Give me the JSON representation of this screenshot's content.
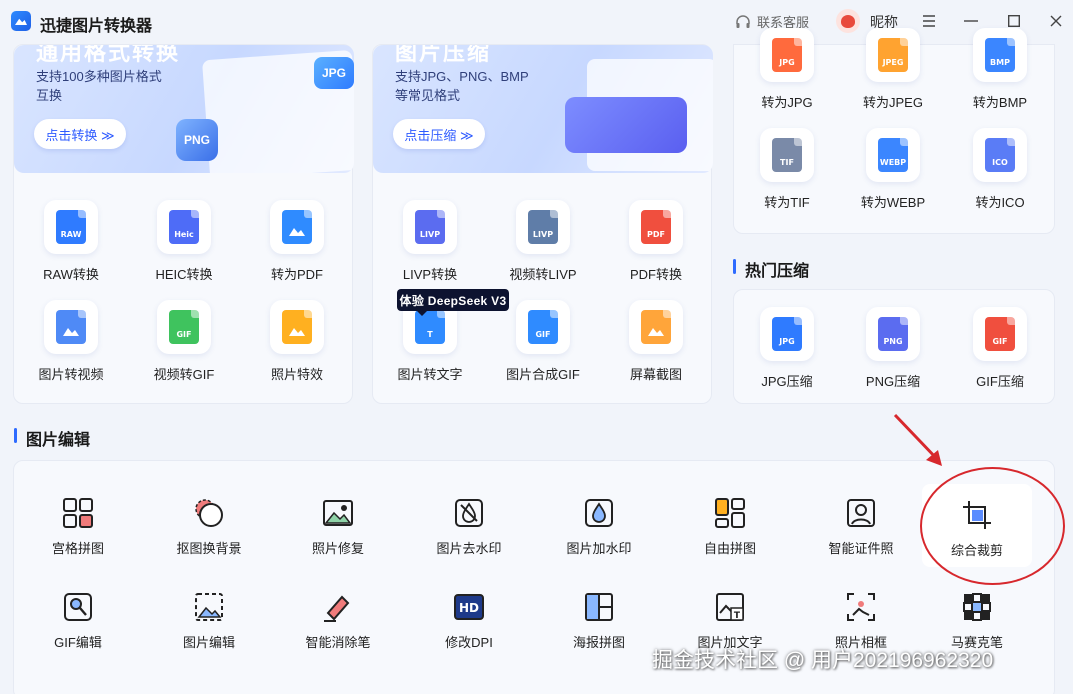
{
  "app": {
    "title": "迅捷图片转换器",
    "support_label": "联系客服",
    "nickname": "昵称"
  },
  "format_convert": {
    "banner": {
      "title": "通用格式转换",
      "desc": "支持100多种图片格式\n互换",
      "button": "点击转换 ≫"
    },
    "tools": [
      {
        "label": "RAW转换",
        "icon": "raw-file-icon",
        "badge": "RAW",
        "color": "#2f7bff"
      },
      {
        "label": "HEIC转换",
        "icon": "heic-file-icon",
        "badge": "Heic",
        "color": "#4e6cf7"
      },
      {
        "label": "转为PDF",
        "icon": "pdf-convert-icon",
        "badge": "",
        "color": "#2f8bff"
      },
      {
        "label": "图片转视频",
        "icon": "image-to-video-icon",
        "badge": "",
        "color": "#4f8af6"
      },
      {
        "label": "视频转GIF",
        "icon": "video-to-gif-icon",
        "badge": "GIF",
        "color": "#3fc35e"
      },
      {
        "label": "照片特效",
        "icon": "photo-effects-icon",
        "badge": "",
        "color": "#ffb020"
      }
    ]
  },
  "image_compress": {
    "banner": {
      "title": "图片压缩",
      "desc": "支持JPG、PNG、BMP\n等常见格式",
      "button": "点击压缩 ≫"
    },
    "tools": [
      {
        "label": "LIVP转换",
        "icon": "livp-file-icon",
        "badge": "LIVP",
        "color": "#5b6cf0"
      },
      {
        "label": "视频转LIVP",
        "icon": "video-to-livp-icon",
        "badge": "LIVP",
        "color": "#5f7da8"
      },
      {
        "label": "PDF转换",
        "icon": "pdf-file-icon",
        "badge": "PDF",
        "color": "#f04f3e"
      },
      {
        "label": "图片转文字",
        "icon": "image-to-text-icon",
        "badge": "T",
        "color": "#2f8bff"
      },
      {
        "label": "图片合成GIF",
        "icon": "gif-compose-icon",
        "badge": "GIF",
        "color": "#2f8bff"
      },
      {
        "label": "屏幕截图",
        "icon": "screenshot-icon",
        "badge": "",
        "color": "#ffa53a"
      }
    ],
    "deepseek_badge": "体验 DeepSeek V3"
  },
  "convert_to": {
    "tools": [
      {
        "label": "转为JPG",
        "icon": "jpg-file-icon",
        "badge": "JPG",
        "color": "#ff6a3d"
      },
      {
        "label": "转为JPEG",
        "icon": "jpeg-file-icon",
        "badge": "JPEG",
        "color": "#ffa330"
      },
      {
        "label": "转为BMP",
        "icon": "bmp-file-icon",
        "badge": "BMP",
        "color": "#3b86ff"
      },
      {
        "label": "转为TIF",
        "icon": "tif-file-icon",
        "badge": "TIF",
        "color": "#7a8aa8"
      },
      {
        "label": "转为WEBP",
        "icon": "webp-file-icon",
        "badge": "WEBP",
        "color": "#3b86ff"
      },
      {
        "label": "转为ICO",
        "icon": "ico-file-icon",
        "badge": "ICO",
        "color": "#5a7cf6"
      }
    ]
  },
  "hot_compress": {
    "title": "热门压缩",
    "tools": [
      {
        "label": "JPG压缩",
        "icon": "jpg-compress-icon",
        "badge": "JPG",
        "color": "#2f7bff"
      },
      {
        "label": "PNG压缩",
        "icon": "png-compress-icon",
        "badge": "PNG",
        "color": "#5b6cf0"
      },
      {
        "label": "GIF压缩",
        "icon": "gif-compress-icon",
        "badge": "GIF",
        "color": "#f04f3e"
      }
    ]
  },
  "image_edit": {
    "title": "图片编辑",
    "tools": [
      {
        "label": "宫格拼图",
        "icon": "grid-collage-icon"
      },
      {
        "label": "抠图换背景",
        "icon": "cutout-background-icon"
      },
      {
        "label": "照片修复",
        "icon": "photo-repair-icon"
      },
      {
        "label": "图片去水印",
        "icon": "remove-watermark-icon"
      },
      {
        "label": "图片加水印",
        "icon": "add-watermark-icon"
      },
      {
        "label": "自由拼图",
        "icon": "free-collage-icon"
      },
      {
        "label": "智能证件照",
        "icon": "id-photo-icon"
      },
      {
        "label": "综合裁剪",
        "icon": "crop-icon"
      },
      {
        "label": "GIF编辑",
        "icon": "gif-edit-icon"
      },
      {
        "label": "图片编辑",
        "icon": "image-edit-icon"
      },
      {
        "label": "智能消除笔",
        "icon": "eraser-pen-icon"
      },
      {
        "label": "修改DPI",
        "icon": "hd-dpi-icon"
      },
      {
        "label": "海报拼图",
        "icon": "poster-collage-icon"
      },
      {
        "label": "图片加文字",
        "icon": "add-text-icon"
      },
      {
        "label": "照片相框",
        "icon": "photo-frame-icon"
      },
      {
        "label": "马赛克笔",
        "icon": "mosaic-pen-icon"
      }
    ]
  },
  "watermark": "掘金技术社区 @ 用户202196962320"
}
